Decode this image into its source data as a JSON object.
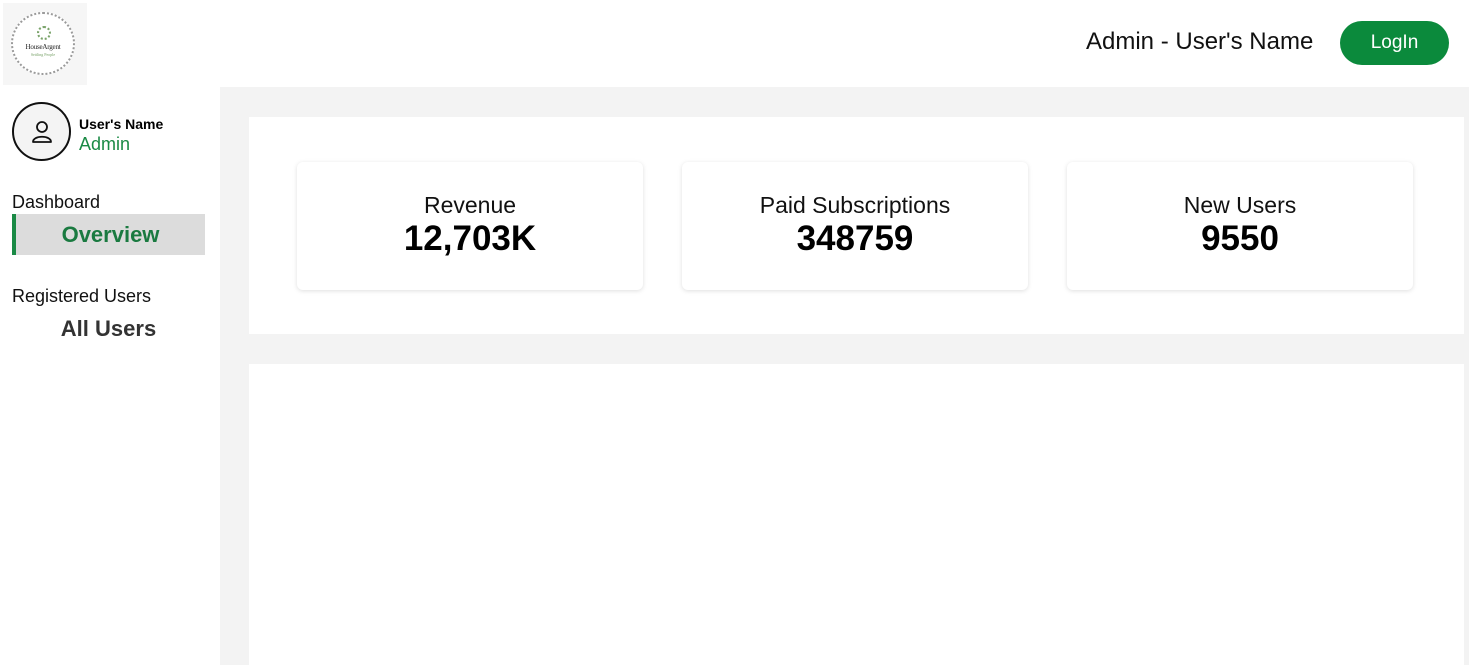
{
  "brand": {
    "name": "HouseArgent",
    "tagline": "Settling People",
    "accent": "#0b8a3c"
  },
  "header": {
    "user_text": "Admin - User's Name",
    "login_label": "LogIn"
  },
  "sidebar": {
    "profile": {
      "name": "User's Name",
      "role": "Admin"
    },
    "sections": [
      {
        "label": "Dashboard",
        "items": [
          {
            "label": "Overview",
            "active": true
          }
        ]
      },
      {
        "label": "Registered Users",
        "items": [
          {
            "label": "All Users",
            "active": false
          }
        ]
      }
    ]
  },
  "stats": [
    {
      "label": "Revenue",
      "value": "12,703K"
    },
    {
      "label": "Paid Subscriptions",
      "value": "348759"
    },
    {
      "label": "New Users",
      "value": "9550"
    }
  ],
  "icons": {
    "avatar": "user-icon",
    "logo": "wreath-icon"
  }
}
